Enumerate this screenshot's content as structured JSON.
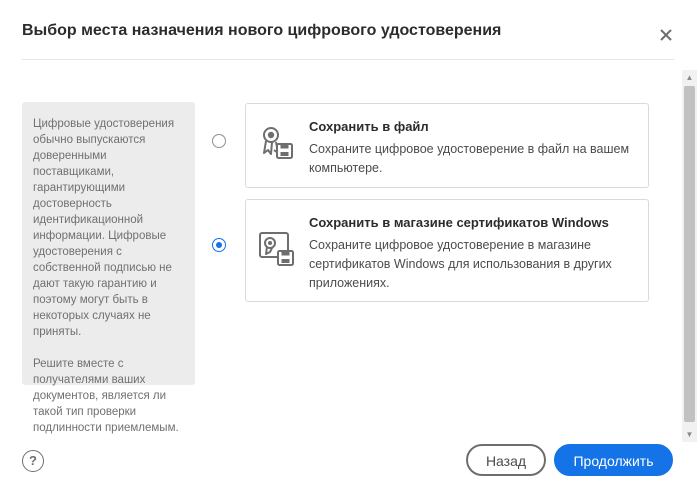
{
  "dialog": {
    "title": "Выбор места назначения нового цифрового удостоверения",
    "close_icon": "close-icon"
  },
  "info": {
    "paragraph_1": "Цифровые удостоверения обычно выпускаются доверенными поставщиками, гарантирующими достоверность идентификационной информации. Цифровые удостоверения с собственной подписью не дают такую гарантию и поэтому могут быть в некоторых случаях не приняты.",
    "paragraph_2": "Решите вместе с получателями ваших документов, является ли такой тип проверки подлинности приемлемым."
  },
  "options": [
    {
      "title": "Сохранить в файл",
      "description": "Сохраните цифровое удостоверение в файл на вашем компьютере.",
      "selected": false,
      "icon": "certificate-file-icon"
    },
    {
      "title": "Сохранить в магазине сертификатов Windows",
      "description": "Сохраните цифровое удостоверение в магазине сертификатов Windows для использования в других приложениях.",
      "selected": true,
      "icon": "certificate-store-icon"
    }
  ],
  "footer": {
    "help_label": "?",
    "back_label": "Назад",
    "continue_label": "Продолжить"
  },
  "colors": {
    "accent": "#1473e6",
    "panel_bg": "#ececec",
    "border": "#dadada"
  }
}
